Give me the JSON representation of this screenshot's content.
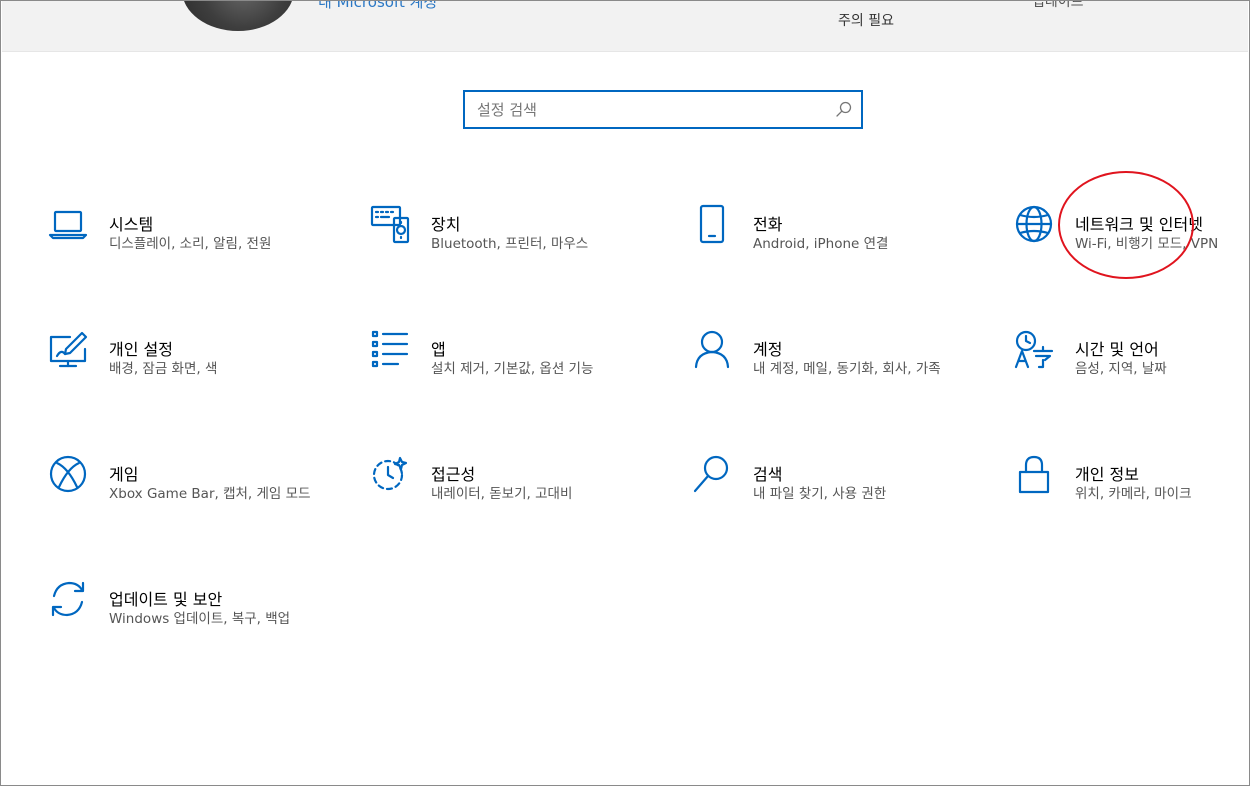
{
  "header": {
    "account_link": "내 Microsoft 계정",
    "attention": "주의 필요",
    "right_label": "업데이트"
  },
  "search": {
    "placeholder": "설정 검색"
  },
  "tiles": [
    {
      "title": "시스템",
      "subtitle": "디스플레이, 소리, 알림, 전원",
      "icon": "laptop-icon"
    },
    {
      "title": "장치",
      "subtitle": "Bluetooth, 프린터, 마우스",
      "icon": "devices-icon"
    },
    {
      "title": "전화",
      "subtitle": "Android, iPhone 연결",
      "icon": "phone-icon"
    },
    {
      "title": "네트워크 및 인터넷",
      "subtitle": "Wi-Fi, 비행기 모드, VPN",
      "icon": "globe-icon"
    },
    {
      "title": "개인 설정",
      "subtitle": "배경, 잠금 화면, 색",
      "icon": "personalization-icon"
    },
    {
      "title": "앱",
      "subtitle": "설치 제거, 기본값, 옵션 기능",
      "icon": "apps-list-icon"
    },
    {
      "title": "계정",
      "subtitle": "내 계정, 메일, 동기화, 회사, 가족",
      "icon": "person-icon"
    },
    {
      "title": "시간 및 언어",
      "subtitle": "음성, 지역, 날짜",
      "icon": "time-language-icon"
    },
    {
      "title": "게임",
      "subtitle": "Xbox Game Bar, 캡처, 게임 모드",
      "icon": "xbox-icon"
    },
    {
      "title": "접근성",
      "subtitle": "내레이터, 돋보기, 고대비",
      "icon": "accessibility-icon"
    },
    {
      "title": "검색",
      "subtitle": "내 파일 찾기, 사용 권한",
      "icon": "search-icon"
    },
    {
      "title": "개인 정보",
      "subtitle": "위치, 카메라, 마이크",
      "icon": "lock-icon"
    },
    {
      "title": "업데이트 및 보안",
      "subtitle": "Windows 업데이트, 복구, 백업",
      "icon": "sync-icon"
    }
  ],
  "colors": {
    "accent": "#0067c0",
    "annotation": "#e0141e"
  }
}
